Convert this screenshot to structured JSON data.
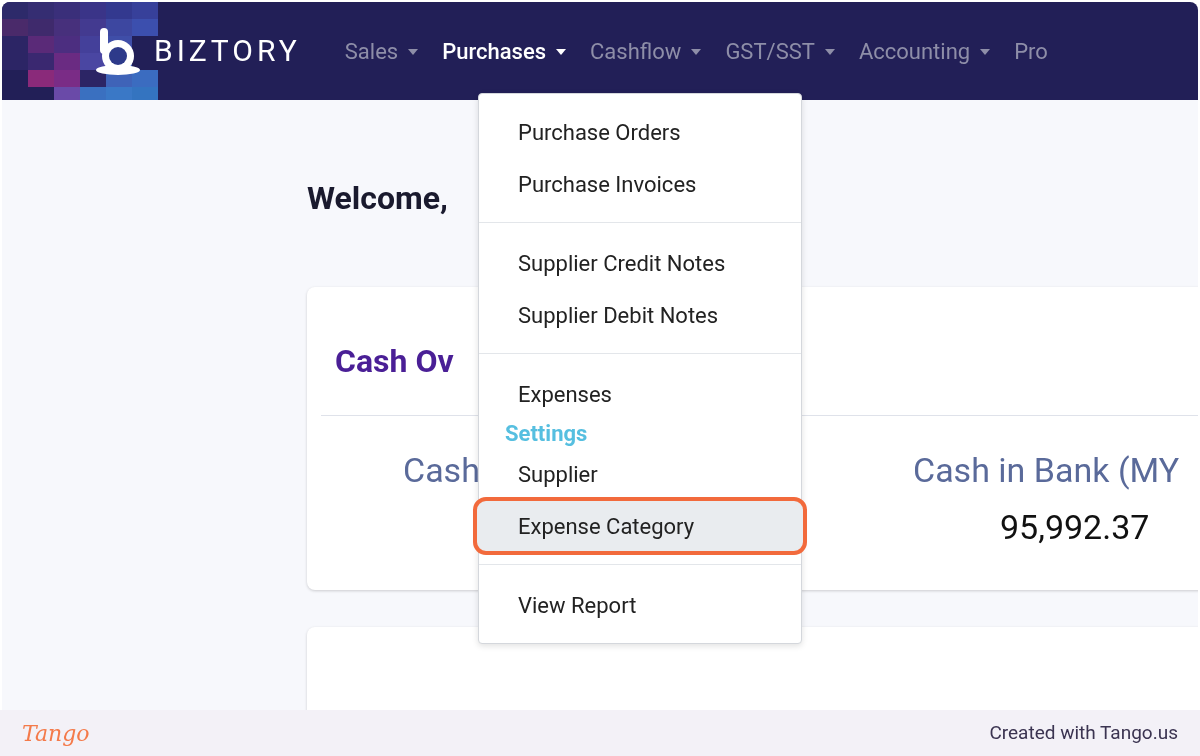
{
  "nav": {
    "brand": "BIZTORY",
    "items": [
      {
        "label": "Sales",
        "selected": false
      },
      {
        "label": "Purchases",
        "selected": true
      },
      {
        "label": "Cashflow",
        "selected": false
      },
      {
        "label": "GST/SST",
        "selected": false
      },
      {
        "label": "Accounting",
        "selected": false
      },
      {
        "label": "Pro",
        "selected": false
      }
    ]
  },
  "dropdown": {
    "groups": [
      [
        {
          "kind": "item",
          "label": "Purchase Orders",
          "highlighted": false
        },
        {
          "kind": "item",
          "label": "Purchase Invoices",
          "highlighted": false
        }
      ],
      [
        {
          "kind": "item",
          "label": "Supplier Credit Notes",
          "highlighted": false
        },
        {
          "kind": "item",
          "label": "Supplier Debit Notes",
          "highlighted": false
        }
      ],
      [
        {
          "kind": "item",
          "label": "Expenses",
          "highlighted": false
        },
        {
          "kind": "heading",
          "label": "Settings"
        },
        {
          "kind": "item",
          "label": "Supplier",
          "highlighted": false
        },
        {
          "kind": "item",
          "label": "Expense Category",
          "highlighted": true
        }
      ],
      [
        {
          "kind": "item",
          "label": "View Report",
          "highlighted": false
        }
      ]
    ]
  },
  "page": {
    "welcome": "Welcome,",
    "card": {
      "title": "Cash Ov",
      "stats": [
        {
          "label": "Cash"
        },
        {
          "label": "Cash in Bank (MY",
          "value": "95,992.37"
        }
      ]
    }
  },
  "footer": {
    "logo": "Tango",
    "credit": "Created with Tango.us"
  }
}
